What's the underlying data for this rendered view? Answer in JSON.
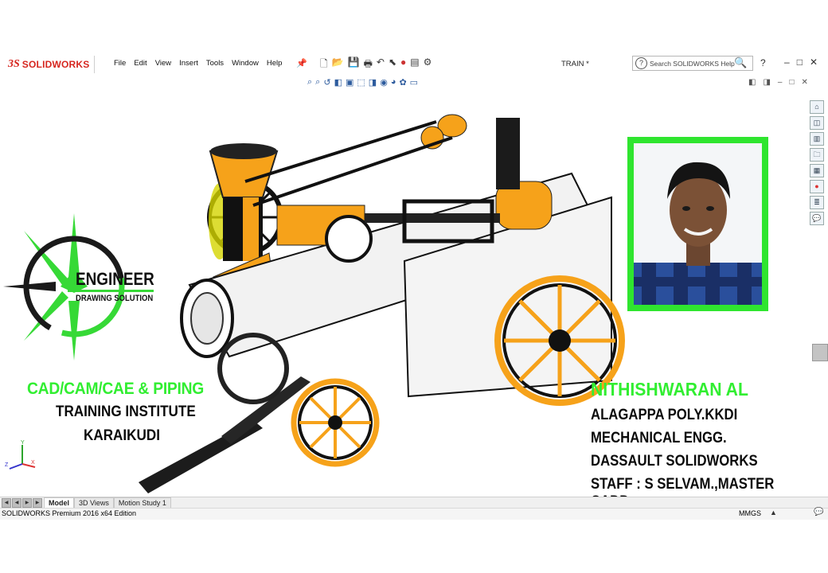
{
  "app": {
    "logo_ds": "3S",
    "logo_name": "SOLIDWORKS",
    "menu": [
      "File",
      "Edit",
      "View",
      "Insert",
      "Tools",
      "Window",
      "Help"
    ],
    "document_title": "TRAIN *",
    "search_placeholder": "Search SOLIDWORKS Help",
    "help_label": "?",
    "window_buttons": [
      "–",
      "□",
      "✕"
    ]
  },
  "tabs": {
    "items": [
      "Model",
      "3D Views",
      "Motion Study 1"
    ],
    "active": "Model"
  },
  "status": {
    "edition": "SOLIDWORKS Premium 2016 x64 Edition",
    "units": "MMGS"
  },
  "logo": {
    "line1": "ENGINEER",
    "line2": "DRAWING SOLUTION",
    "accent": "#36d936"
  },
  "left_text": {
    "line1": "CAD/CAM/CAE  & PIPING",
    "line2": "TRAINING INSTITUTE",
    "line3": "KARAIKUDI"
  },
  "right_text": {
    "name": "NITHISHWARAN AL",
    "line1": "ALAGAPPA POLY.KKDI",
    "line2": "MECHANICAL ENGG.",
    "line3": "DASSAULT SOLIDWORKS",
    "line4": "STAFF : S SELVAM.,MASTER  CADD"
  },
  "colors": {
    "green": "#31ee31",
    "orange": "#f6a21a",
    "solidworks_red": "#d6261f"
  },
  "triad": {
    "x": "X",
    "y": "Y",
    "z": "Z"
  }
}
